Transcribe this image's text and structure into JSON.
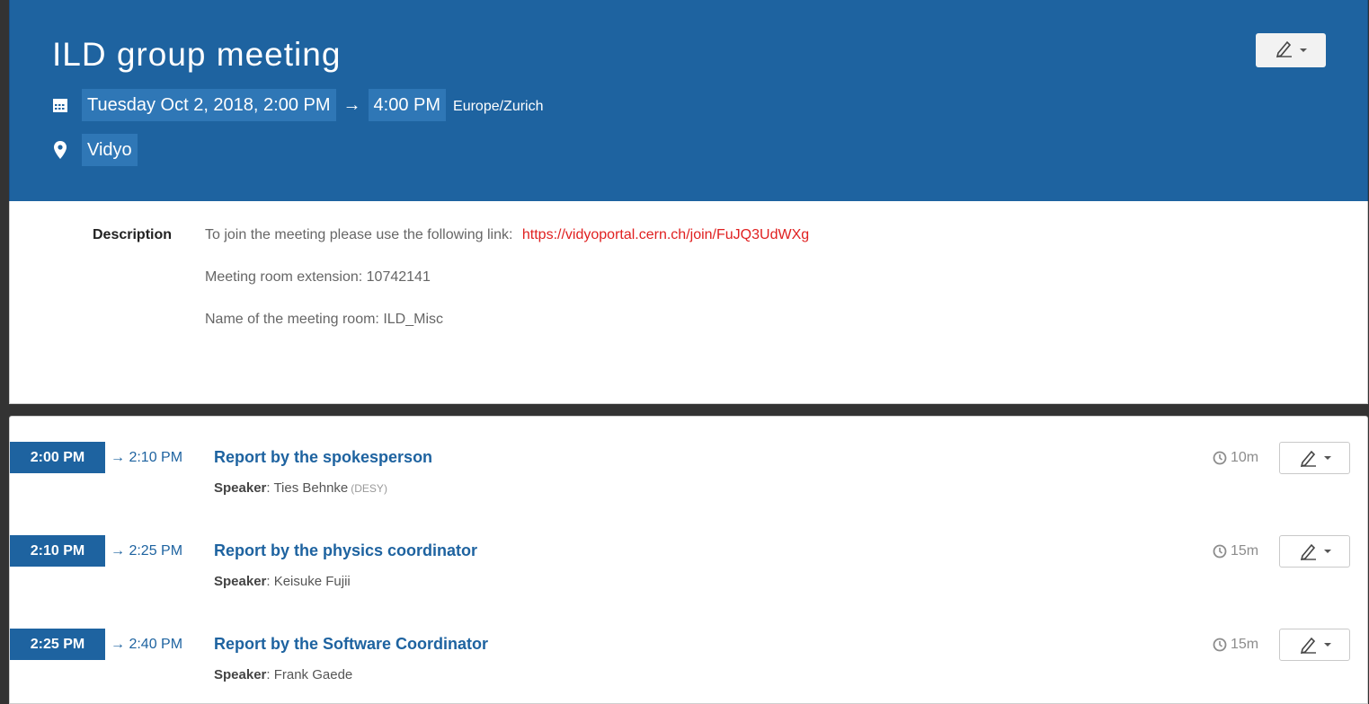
{
  "event": {
    "title": "ILD group meeting",
    "date_start": "Tuesday Oct 2, 2018, 2:00 PM",
    "arrow": "→",
    "time_end": "4:00 PM",
    "timezone": "Europe/Zurich",
    "location": "Vidyo"
  },
  "description": {
    "label": "Description",
    "line1_text": "To join the meeting please use the following link:",
    "line1_link": "https://vidyoportal.cern.ch/join/FuJQ3UdWXg",
    "line2": "Meeting room extension: 10742141",
    "line3": "Name of the meeting room: ILD_Misc"
  },
  "icons": {
    "calendar": "calendar-icon",
    "location": "map-marker-icon",
    "edit": "pencil-icon",
    "duration": "clock-icon"
  },
  "colors": {
    "header_bg": "#1e63a0",
    "chip_bg": "#2f77b6",
    "link": "#e02020"
  },
  "contributions": [
    {
      "start": "2:00 PM",
      "end": "→ 2:10 PM",
      "title": "Report by the spokesperson",
      "speaker_label": "Speaker",
      "speaker": ": Ties Behnke",
      "affiliation": "(DESY)",
      "duration": "10m"
    },
    {
      "start": "2:10 PM",
      "end": "→ 2:25 PM",
      "title": "Report by the physics coordinator",
      "speaker_label": "Speaker",
      "speaker": ": Keisuke Fujii",
      "affiliation": "",
      "duration": "15m"
    },
    {
      "start": "2:25 PM",
      "end": "→ 2:40 PM",
      "title": "Report by the Software Coordinator",
      "speaker_label": "Speaker",
      "speaker": ": Frank Gaede",
      "affiliation": "",
      "duration": "15m"
    }
  ]
}
